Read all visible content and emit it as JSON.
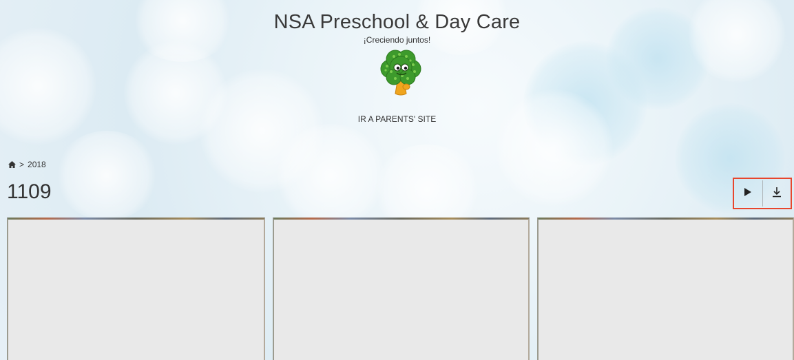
{
  "header": {
    "site_title": "NSA Preschool & Day Care",
    "tagline": "¡Creciendo juntos!",
    "logo_icon": "broccoli-mascot-icon",
    "parents_link": "IR A PARENTS' SITE"
  },
  "breadcrumb": {
    "home_icon": "home-icon",
    "separator": ">",
    "items": [
      "2018"
    ]
  },
  "album": {
    "title": "1109"
  },
  "toolbar": {
    "play_icon": "play-icon",
    "download_icon": "download-icon",
    "highlight_color": "#e8462d"
  },
  "gallery": {
    "thumbnails": [
      {
        "name": "photo-thumbnail-1"
      },
      {
        "name": "photo-thumbnail-2"
      },
      {
        "name": "photo-thumbnail-3"
      }
    ],
    "placeholder_color": "#e9e9e9"
  }
}
